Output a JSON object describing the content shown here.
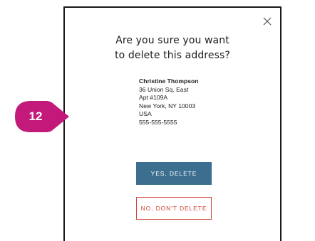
{
  "modal": {
    "title_line1": "Are you sure you want",
    "title_line2": "to delete this address?",
    "close_icon": "close-icon",
    "address": {
      "name": "Christine Thompson",
      "line1": "36 Union Sq. East",
      "line2": "Apt #109A",
      "city_state_zip": "New York, NY 10003",
      "country": "USA",
      "phone": "555-555-5555"
    },
    "confirm_label": "YES, DELETE",
    "cancel_label": "NO, DON'T DELETE"
  },
  "annotation": {
    "step_number": "12",
    "color": "#c2197a"
  },
  "colors": {
    "confirm_bg": "#3b6e8f",
    "cancel_accent": "#d0453b",
    "modal_border": "#1a1a1a"
  }
}
